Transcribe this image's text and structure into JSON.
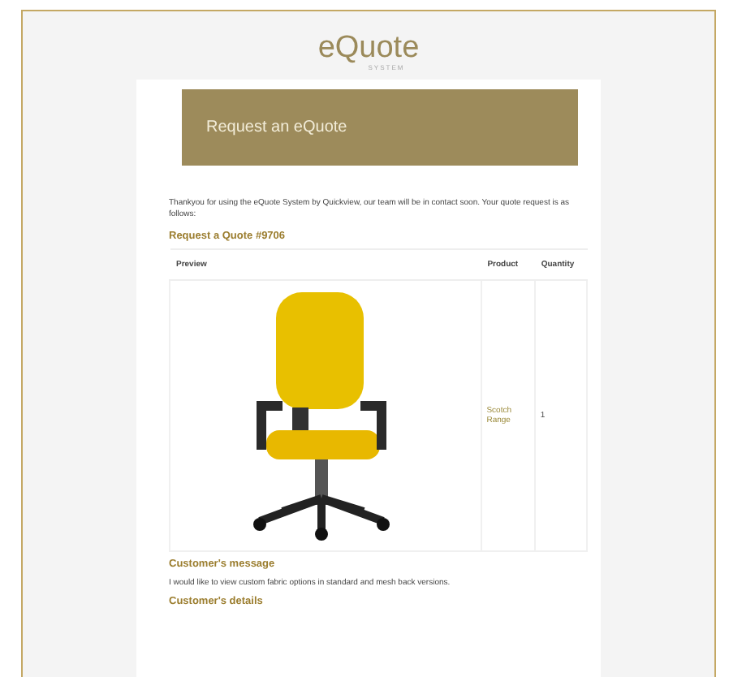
{
  "logo": {
    "name": "eQuote",
    "tagline": "SYSTEM"
  },
  "banner": {
    "title": "Request an eQuote"
  },
  "intro": "Thankyou for using the eQuote System by Quickview, our team will be in contact soon. Your quote request is as follows:",
  "quote": {
    "heading": "Request a Quote #9706",
    "columns": [
      "Preview",
      "Product",
      "Quantity"
    ],
    "rows": [
      {
        "product": "Scotch Range",
        "quantity": "1"
      }
    ]
  },
  "message": {
    "heading": "Customer's message",
    "text": "I would like to view custom fabric options in standard and mesh back versions."
  },
  "details": {
    "heading": "Customer's details"
  }
}
